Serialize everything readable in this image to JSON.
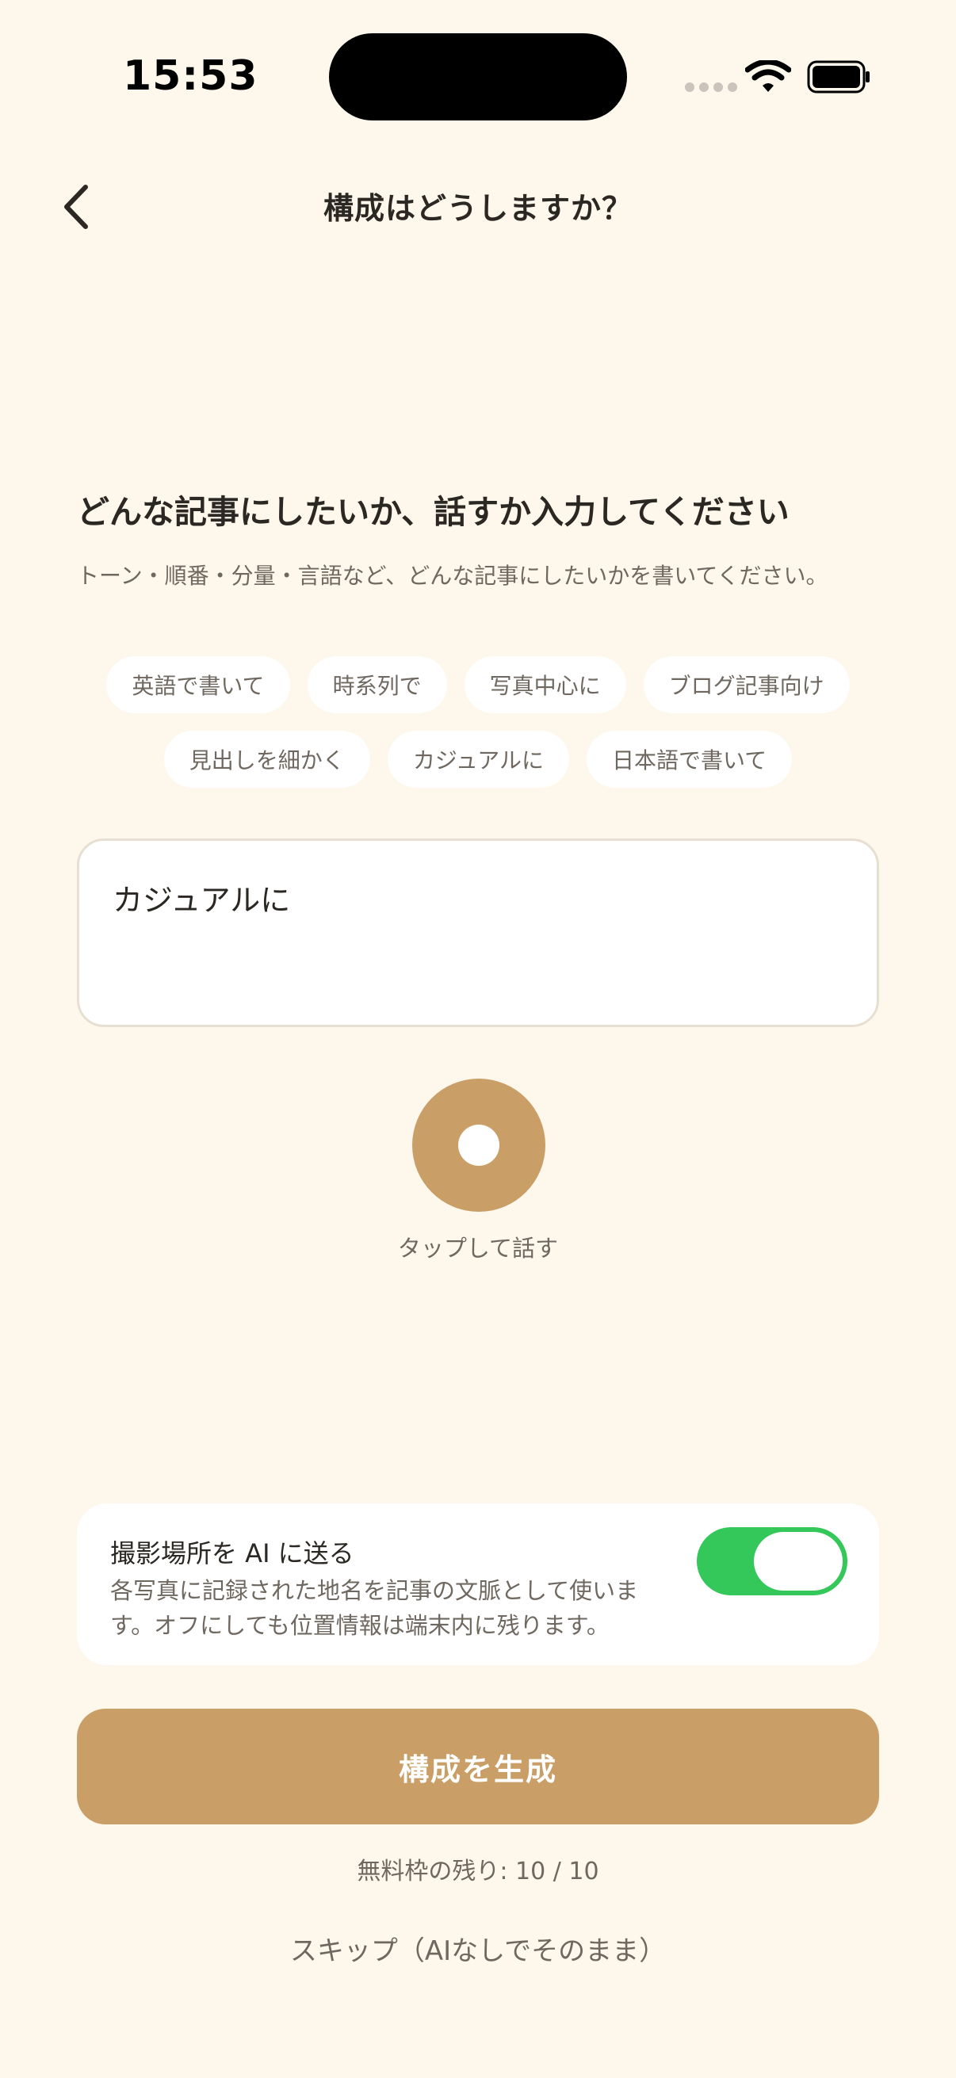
{
  "status_bar": {
    "time": "15:53"
  },
  "nav": {
    "title": "構成はどうしますか？"
  },
  "prompt": {
    "heading": "どんな記事にしたいか、話すか入力してください",
    "subtitle": "トーン・順番・分量・言語など、どんな記事にしたいかを書いてください。"
  },
  "chips": {
    "row1": [
      "英語で書いて",
      "時系列で",
      "写真中心に",
      "ブログ記事向け"
    ],
    "row2": [
      "見出しを細かく",
      "カジュアルに",
      "日本語で書いて"
    ]
  },
  "input": {
    "value": "カジュアルに"
  },
  "voice": {
    "label": "タップして話す"
  },
  "location": {
    "title": "撮影場所を AI に送る",
    "description": "各写真に記録された地名を記事の文脈として使います。オフにしても位置情報は端末内に残ります。",
    "enabled": true
  },
  "actions": {
    "generate_label": "構成を生成",
    "quota_text": "無料枠の残り: 10 / 10",
    "skip_label": "スキップ（AIなしでそのまま）"
  },
  "colors": {
    "background": "#FEF7EB",
    "accent": "#C99F67",
    "toggle_on": "#34C759"
  }
}
